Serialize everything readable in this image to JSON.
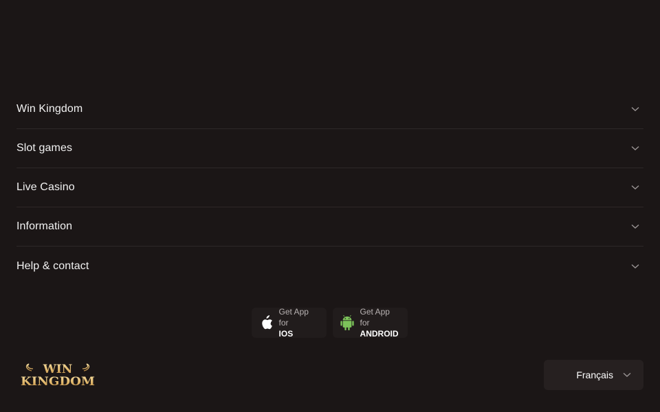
{
  "footer": {
    "sections": [
      {
        "label": "Win Kingdom"
      },
      {
        "label": "Slot games"
      },
      {
        "label": "Live Casino"
      },
      {
        "label": "Information"
      },
      {
        "label": "Help & contact"
      }
    ],
    "apps": {
      "ios": {
        "line1": "Get App for",
        "line2": "IOS",
        "icon": "apple-icon"
      },
      "android": {
        "line1": "Get App for",
        "line2": "ANDROID",
        "icon": "android-icon",
        "color": "#7cc35a"
      }
    },
    "logo": {
      "line1": "WIN",
      "line2": "KINGDOM",
      "color": "#e8c27a"
    },
    "language": {
      "selected": "Français"
    }
  },
  "colors": {
    "background": "#1b1616",
    "divider": "#2e2828",
    "button_bg": "#211c1c"
  }
}
